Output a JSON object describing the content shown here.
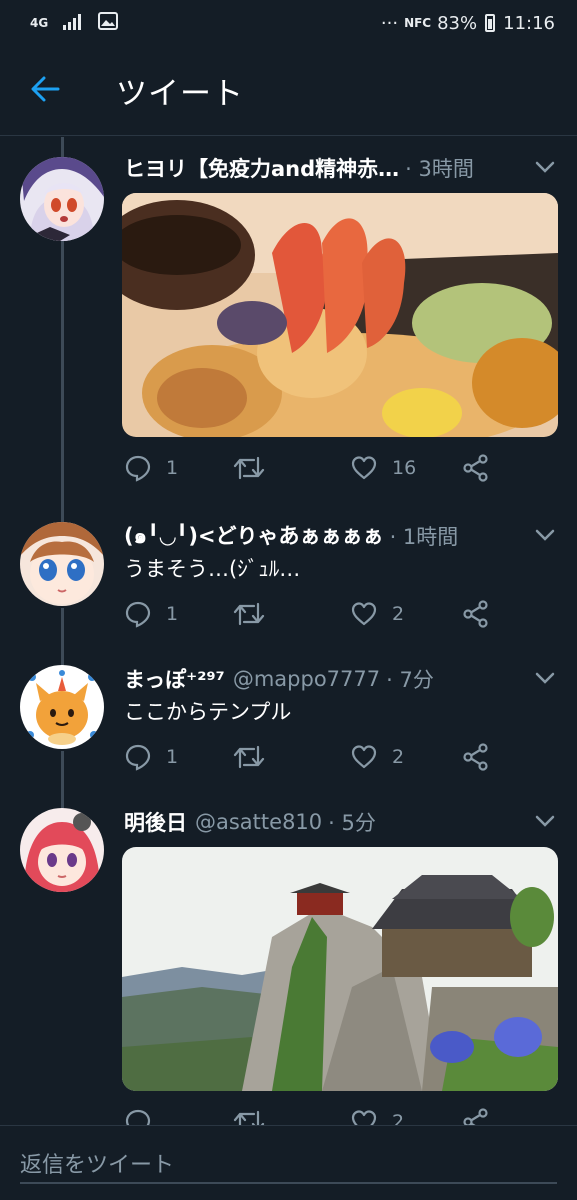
{
  "status_bar": {
    "network": "4G",
    "nfc": "NFC",
    "battery": "83%",
    "time": "11:16"
  },
  "header": {
    "title": "ツイート"
  },
  "tweets": [
    {
      "name": "ヒヨリ【免疫力and精神赤…",
      "handle": "",
      "time": "· 3時間",
      "text": "",
      "replies": "1",
      "retweets": "",
      "likes": "16"
    },
    {
      "name": "(๑╹◡╹)<どりゃあぁぁぁぁ",
      "handle": "",
      "time": "· 1時間",
      "text": "うまそう…(ｼﾞｭﾙ…",
      "replies": "1",
      "retweets": "",
      "likes": "2"
    },
    {
      "name": "まっぽ⁺²⁹⁷",
      "handle": "@mappo7777",
      "time": "· 7分",
      "text": "ここからテンプル",
      "replies": "1",
      "retweets": "",
      "likes": "2"
    },
    {
      "name": "明後日",
      "handle": "@asatte810",
      "time": "· 5分",
      "text": "",
      "replies": "",
      "retweets": "",
      "likes": "2"
    }
  ],
  "reply_bar": {
    "placeholder": "返信をツイート"
  },
  "colors": {
    "background": "#141d26",
    "accent": "#1da1f2",
    "muted": "#8899a6",
    "divider": "#2a3642"
  }
}
